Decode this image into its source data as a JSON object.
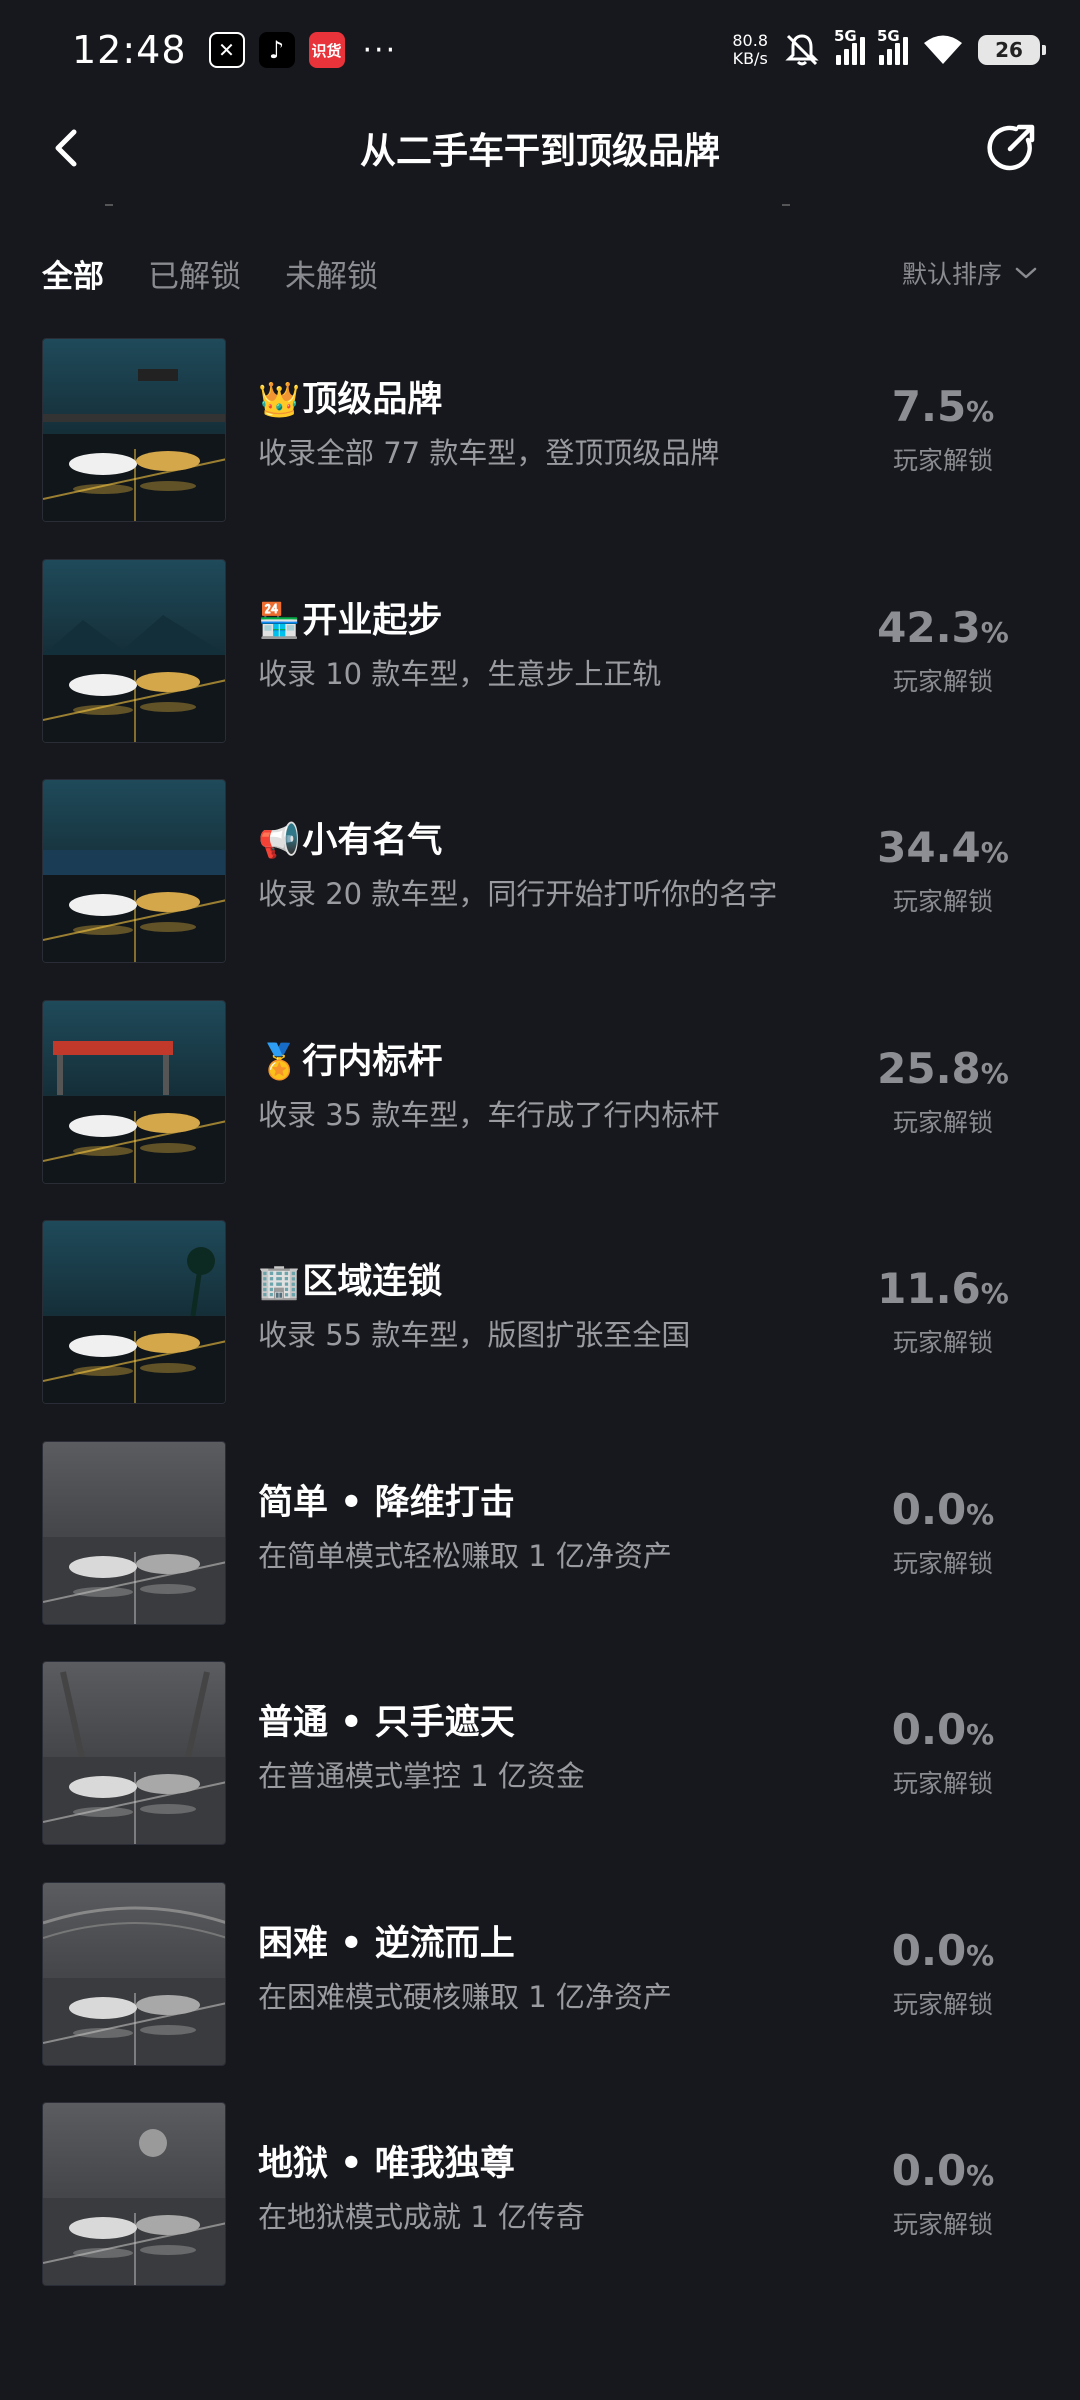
{
  "status_bar": {
    "time": "12:48",
    "app_icons": [
      "capcut-icon",
      "tiktok-icon",
      "shop-icon"
    ],
    "shop_icon_text": "识货",
    "more": "···",
    "net_speed_value": "80.8",
    "net_speed_unit": "KB/s",
    "signal1_label": "5G",
    "signal2_label": "5G",
    "battery": "26"
  },
  "header": {
    "title": "从二手车干到顶级品牌"
  },
  "tabs": [
    {
      "label": "全部",
      "active": true
    },
    {
      "label": "已解锁",
      "active": false
    },
    {
      "label": "未解锁",
      "active": false
    }
  ],
  "sort_label": "默认排序",
  "percent_unit": "%",
  "items": [
    {
      "emoji": "👑",
      "title": "顶级品牌",
      "desc": "收录全部 77 款车型，登顶顶级品牌",
      "pct": "7.5",
      "label": "玩家解锁",
      "unlocked": true,
      "scene": "city"
    },
    {
      "emoji": "🏪",
      "title": "开业起步",
      "desc": "收录 10 款车型，生意步上正轨",
      "pct": "42.3",
      "label": "玩家解锁",
      "unlocked": true,
      "scene": "mountain"
    },
    {
      "emoji": "📢",
      "title": "小有名气",
      "desc": "收录 20 款车型，同行开始打听你的名字",
      "pct": "34.4",
      "label": "玩家解锁",
      "unlocked": true,
      "scene": "sea"
    },
    {
      "emoji": "🏅",
      "title": "行内标杆",
      "desc": "收录 35 款车型，车行成了行内标杆",
      "pct": "25.8",
      "label": "玩家解锁",
      "unlocked": true,
      "scene": "station"
    },
    {
      "emoji": "🏢",
      "title": "区域连锁",
      "desc": "收录 55 款车型，版图扩张至全国",
      "pct": "11.6",
      "label": "玩家解锁",
      "unlocked": true,
      "scene": "palm"
    },
    {
      "emoji": "",
      "title": "简单 • 降维打击",
      "desc": "在简单模式轻松赚取 1 亿净资产",
      "pct": "0.0",
      "label": "玩家解锁",
      "unlocked": false,
      "scene": "gray1"
    },
    {
      "emoji": "",
      "title": "普通 • 只手遮天",
      "desc": "在普通模式掌控 1 亿资金",
      "pct": "0.0",
      "label": "玩家解锁",
      "unlocked": false,
      "scene": "gray2"
    },
    {
      "emoji": "",
      "title": "困难 • 逆流而上",
      "desc": "在困难模式硬核赚取 1 亿净资产",
      "pct": "0.0",
      "label": "玩家解锁",
      "unlocked": false,
      "scene": "gray3"
    },
    {
      "emoji": "",
      "title": "地狱 • 唯我独尊",
      "desc": "在地狱模式成就 1 亿传奇",
      "pct": "0.0",
      "label": "玩家解锁",
      "unlocked": false,
      "scene": "gray4"
    }
  ]
}
